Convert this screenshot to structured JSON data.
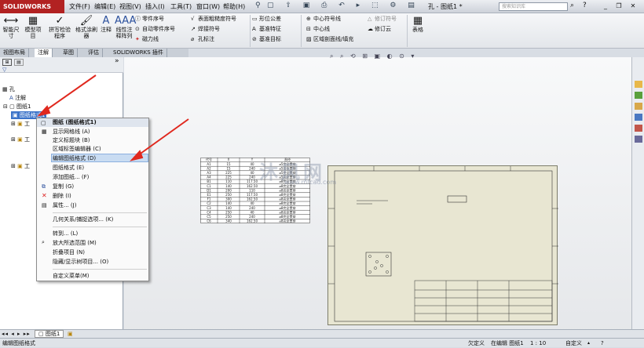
{
  "app": {
    "logo": "SOLIDWORKS",
    "window_title": "孔 - 图纸1 *",
    "search_placeholder": "搜索知识库",
    "menu": [
      "文件(F)",
      "编辑(E)",
      "视图(V)",
      "插入(I)",
      "工具(T)",
      "窗口(W)",
      "帮助(H)"
    ]
  },
  "ribbon": {
    "big_buttons": [
      "智能尺寸",
      "模型项目",
      "拼写检验程序",
      "格式涂刷器",
      "注释",
      "线性注释阵列"
    ],
    "col1": [
      "零件序号",
      "自动零件序号",
      "磁力线"
    ],
    "col2": [
      "表面粗糙度符号",
      "焊接符号",
      "孔标注"
    ],
    "col3": [
      "形位公差",
      "基准特征",
      "基准目标"
    ],
    "col4": [
      "中心符号线",
      "中心线",
      "区域剖面线/填充"
    ],
    "col5": [
      "修订符号",
      "修订云"
    ],
    "table_label": "表格"
  },
  "tabs": [
    "视图布局",
    "注解",
    "草图",
    "评估",
    "SOLIDWORKS 插件"
  ],
  "active_tab": "注解",
  "tree": {
    "root": "孔",
    "annotations": "注解",
    "sheet": "图纸1",
    "sheet_format": "图纸格式1",
    "items": [
      "工",
      "工",
      "工"
    ]
  },
  "context_menu": {
    "title": "图纸 (图纸格式1)",
    "items": [
      "显示网格线 (A)",
      "定义标题块 (B)",
      "区域标签编辑器 (C)",
      "编辑图纸格式 (D)",
      "图纸格式 (E)",
      "添加图纸... (F)",
      "复制 (G)",
      "删除 (I)",
      "属性... (J)",
      "几何关系/捕捉选项... (K)",
      "转到... (L)",
      "放大所选范围 (M)",
      "折叠项目 (N)",
      "隐藏/显示树项目... (O)",
      "自定义菜单(M)"
    ],
    "highlighted": "编辑图纸格式 (D)"
  },
  "drawing_table": {
    "headers": [
      "代号",
      "X",
      "Y",
      "直径"
    ],
    "rows": [
      [
        "A1",
        "15",
        "40",
        "⌀5完全贯穿"
      ],
      [
        "A2",
        "15",
        "240",
        "⌀5完全贯穿"
      ],
      [
        "A3",
        "225",
        "40",
        "⌀5完全贯穿"
      ],
      [
        "A4",
        "225",
        "240",
        "⌀5完全贯穿"
      ],
      [
        "B1",
        "110",
        "117.50",
        "⌀8完全贯穿"
      ],
      [
        "C1",
        "140",
        "162.50",
        "⌀8完全贯穿"
      ],
      [
        "D1",
        "200",
        "110",
        "⌀8完全贯穿"
      ],
      [
        "E1",
        "250",
        "117.50",
        "⌀8完全贯穿"
      ],
      [
        "F1",
        "300",
        "162.50",
        "⌀8完全贯穿"
      ],
      [
        "C2",
        "140",
        "40",
        "⌀8完全贯穿"
      ],
      [
        "C3",
        "140",
        "240",
        "⌀8完全贯穿"
      ],
      [
        "C4",
        "250",
        "40",
        "⌀8完全贯穿"
      ],
      [
        "C5",
        "250",
        "240",
        "⌀8完全贯穿"
      ],
      [
        "C6",
        "340",
        "162.50",
        "⌀8完全贯穿"
      ]
    ]
  },
  "watermark": {
    "big": "沐风网",
    "url": "www.mfcad.com"
  },
  "sheet_tab": "图纸1",
  "status": {
    "left": "编辑图纸格式",
    "under_defined": "欠定义",
    "editing": "在编辑 图纸1",
    "scale": "1 : 10",
    "custom": "自定义"
  },
  "colors": {
    "logo_red": "#b22222",
    "arrow_red": "#e0281e",
    "highlight": "#c9dcf2",
    "sheet_bg": "#e8e6d2"
  }
}
